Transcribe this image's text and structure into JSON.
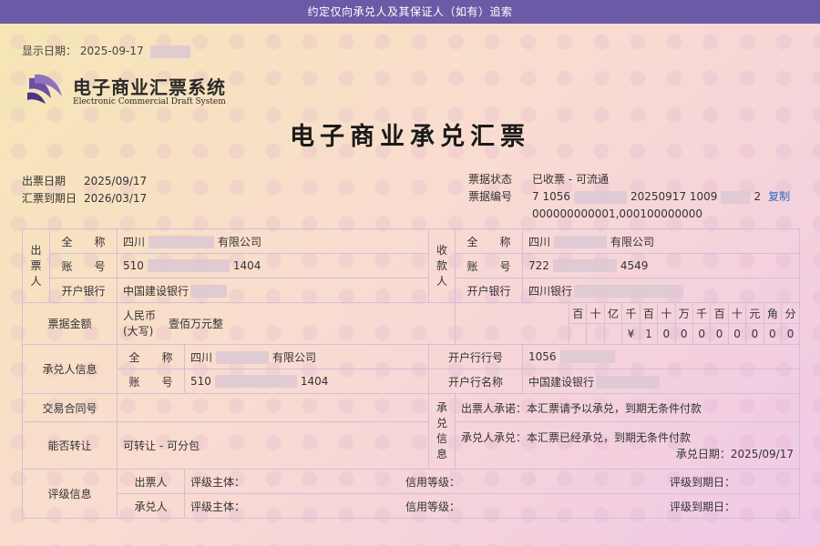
{
  "topbar": {
    "text": "约定仅向承兑人及其保证人（如有）追索"
  },
  "display_date": {
    "label": "显示日期：",
    "value": "2025-09-17"
  },
  "logo": {
    "cn": "电子商业汇票系统",
    "en": "Electronic Commercial Draft System"
  },
  "title": "电子商业承兑汇票",
  "meta": {
    "issue_date_label": "出票日期",
    "issue_date": "2025/09/17",
    "due_date_label": "汇票到期日",
    "due_date": "2026/03/17",
    "status_label": "票据状态",
    "status": "已收票 - 可流通",
    "number_label": "票据编号",
    "number_part1": "7 1056",
    "number_part2": "20250917 1009",
    "number_part3": "2",
    "copy_label": "复制",
    "number_line2": "000000000001,000100000000"
  },
  "drawer": {
    "section_label": [
      "出",
      "票",
      "人"
    ],
    "name_label": "全　　称",
    "name_prefix": "四川",
    "name_suffix": "有限公司",
    "account_label": "账　　号",
    "account_prefix": "510",
    "account_suffix": "1404",
    "bank_label": "开户银行",
    "bank": "中国建设银行"
  },
  "payee": {
    "section_label": [
      "收",
      "款",
      "人"
    ],
    "name_label": "全　　称",
    "name_prefix": "四川",
    "name_suffix": "有限公司",
    "account_label": "账　　号",
    "account_prefix": "722",
    "account_suffix": "4549",
    "bank_label": "开户银行",
    "bank": "四川银行"
  },
  "amount": {
    "label": "票据金额",
    "currency_line1": "人民币",
    "currency_line2": "(大写)",
    "chinese": "壹佰万元整",
    "units": [
      "百",
      "十",
      "亿",
      "千",
      "百",
      "十",
      "万",
      "千",
      "百",
      "十",
      "元",
      "角",
      "分"
    ],
    "digits": [
      "",
      "",
      "",
      "¥",
      "1",
      "0",
      "0",
      "0",
      "0",
      "0",
      "0",
      "0",
      "0"
    ]
  },
  "acceptor": {
    "section_label": "承兑人信息",
    "name_label": "全　　称",
    "name_prefix": "四川",
    "name_suffix": "有限公司",
    "account_label": "账　　号",
    "account_prefix": "510",
    "account_suffix": "1404",
    "bank_no_label": "开户行行号",
    "bank_no": "1056",
    "bank_name_label": "开户行名称",
    "bank_name": "中国建设银行"
  },
  "contract": {
    "label": "交易合同号",
    "value": ""
  },
  "transfer": {
    "label": "能否转让",
    "value": "可转让 - 可分包"
  },
  "acceptance": {
    "section_label": [
      "承",
      "兑",
      "信",
      "息"
    ],
    "drawer_promise": "出票人承诺：本汇票请予以承兑，到期无条件付款",
    "acceptor_promise": "承兑人承兑：本汇票已经承兑，到期无条件付款",
    "accept_date_label": "承兑日期：",
    "accept_date": "2025/09/17"
  },
  "rating": {
    "label": "评级信息",
    "rows": [
      {
        "party": "出票人",
        "subject_label": "评级主体：",
        "grade_label": "信用等级：",
        "expiry_label": "评级到期日："
      },
      {
        "party": "承兑人",
        "subject_label": "评级主体：",
        "grade_label": "信用等级：",
        "expiry_label": "评级到期日："
      }
    ]
  }
}
